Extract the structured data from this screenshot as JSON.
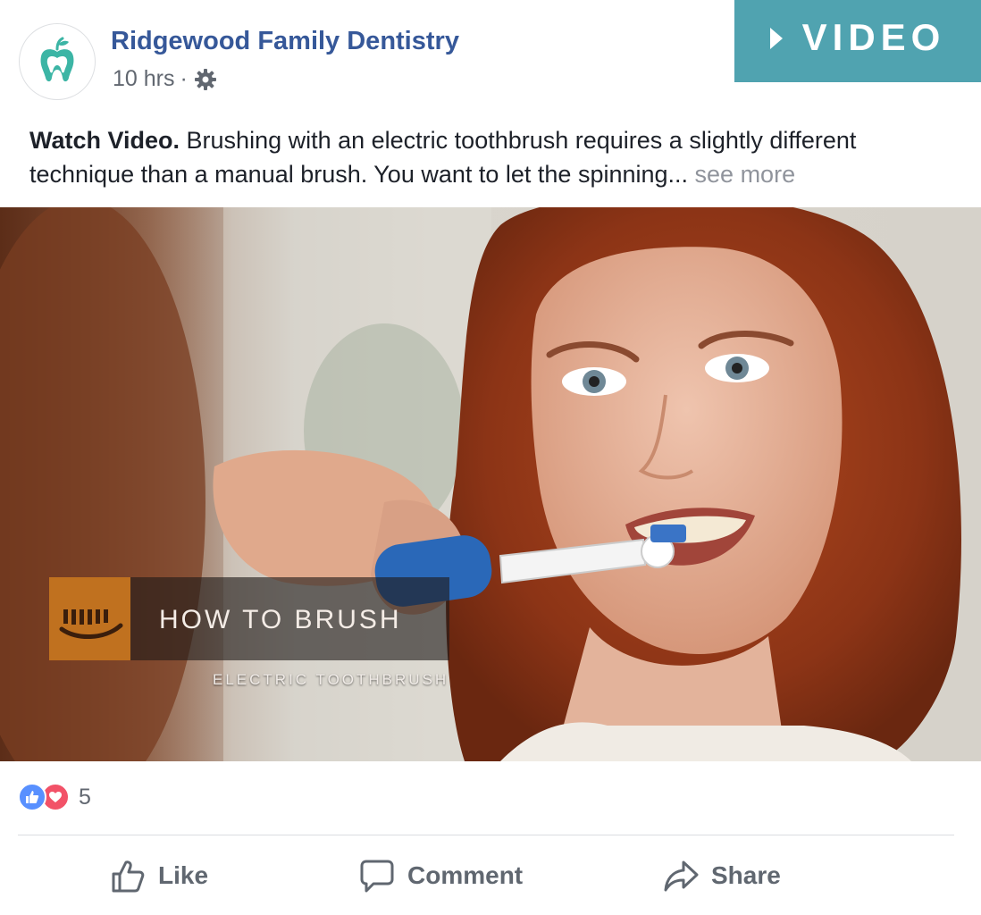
{
  "header": {
    "page_name": "Ridgewood Family Dentistry",
    "time": "10 hrs",
    "separator": "·",
    "avatar_icon": "tooth-apple-logo",
    "privacy_icon": "gear-icon",
    "brand_color": "#365899"
  },
  "badge": {
    "label": "VIDEO",
    "icon": "play-triangle-icon",
    "color": "#50a3b0"
  },
  "post": {
    "lead": "Watch Video.",
    "body": " Brushing with an electric toothbrush requires a slightly different technique than a manual brush. You want to let the spinning... ",
    "see_more": "see more"
  },
  "video": {
    "overlay_title": "HOW TO BRUSH",
    "overlay_subtitle": "ELECTRIC TOOTHBRUSH",
    "overlay_icon": "toothbrush-icon",
    "overlay_accent": "#c0711f"
  },
  "reactions": {
    "types": [
      "like",
      "love"
    ],
    "count": "5"
  },
  "actions": {
    "like": "Like",
    "comment": "Comment",
    "share": "Share"
  }
}
